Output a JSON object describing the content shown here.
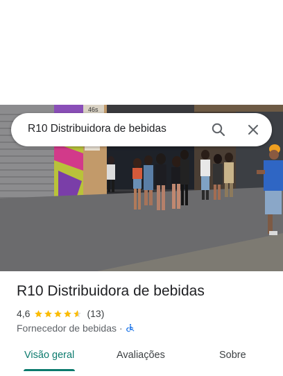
{
  "search": {
    "query": "R10 Distribuidora de bebidas",
    "search_icon": "search-icon",
    "close_icon": "close-icon"
  },
  "hero": {
    "photo_icon": "place-photo",
    "sign_text": "46s"
  },
  "place": {
    "name": "R10 Distribuidora de bebidas",
    "rating": "4,6",
    "stars": 4.6,
    "review_count": "(13)",
    "category": "Fornecedor de bebidas",
    "separator": "·",
    "accessibility_icon": "wheelchair-icon"
  },
  "tabs": [
    {
      "label": "Visão geral",
      "active": true
    },
    {
      "label": "Avaliações",
      "active": false
    },
    {
      "label": "Sobre",
      "active": false
    }
  ],
  "colors": {
    "accent": "#0b7a6d",
    "star": "#fbbc04",
    "accessibility": "#1a73e8"
  }
}
